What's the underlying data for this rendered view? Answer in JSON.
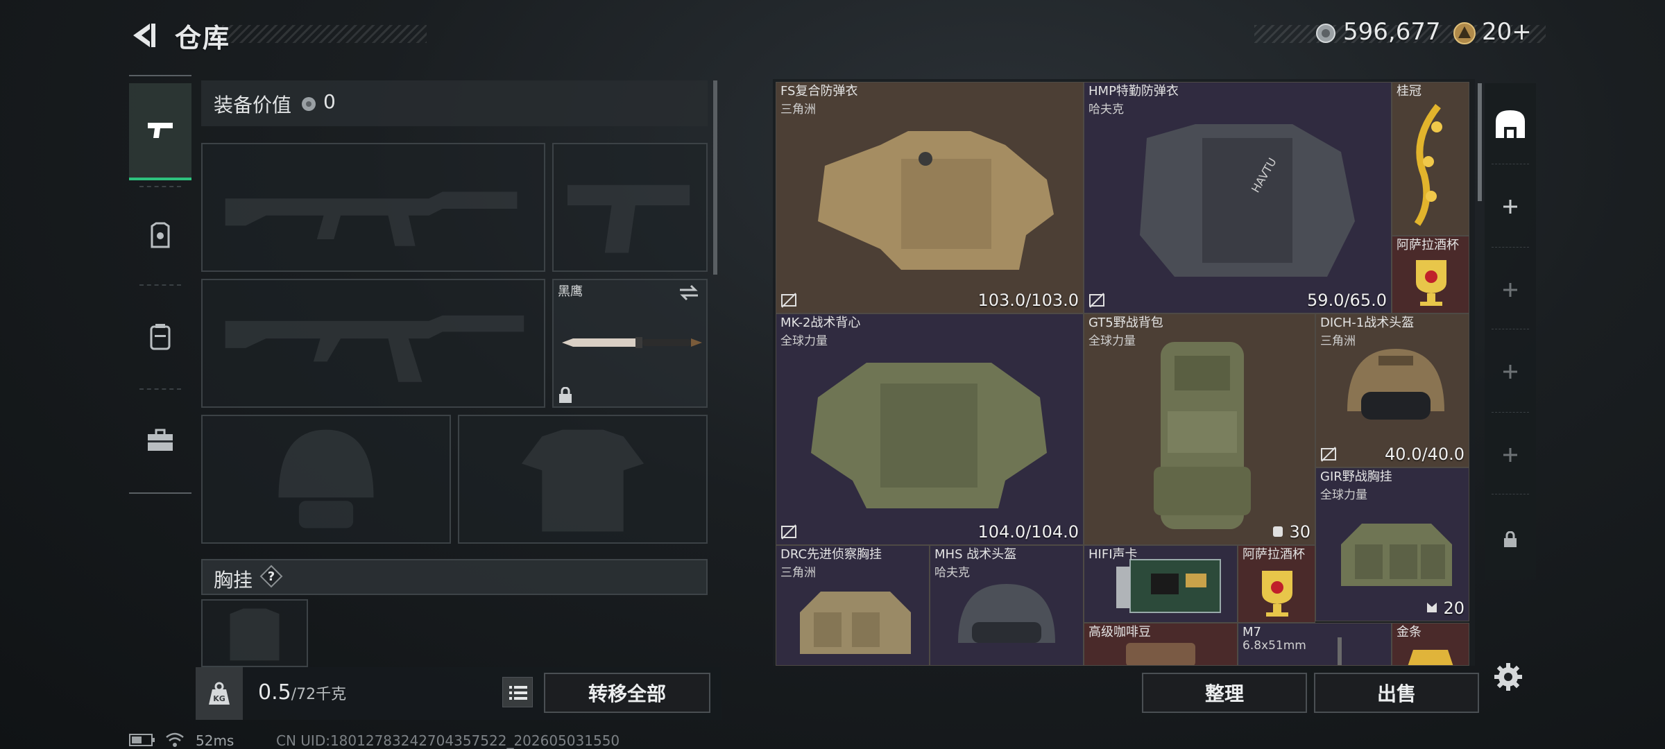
{
  "header": {
    "title": "仓库",
    "coins": "596,677",
    "bonds": "20",
    "bonds_add": "+"
  },
  "equipment": {
    "value_label": "装备价值",
    "value": "0",
    "melee_name": "黑鹰",
    "chest_label": "胸挂",
    "chest_help": "?"
  },
  "footer": {
    "weight_current": "0.5",
    "weight_max": "/72千克",
    "transfer_all": "转移全部",
    "organize": "整理",
    "sell": "出售"
  },
  "status": {
    "ping": "52ms",
    "uid": "CN UID:18012783242704357522_202605031550"
  },
  "storage": {
    "items": [
      {
        "name": "FS复合防弹衣",
        "sub": "三角洲",
        "value": "103.0/103.0"
      },
      {
        "name": "HMP特勤防弹衣",
        "sub": "哈夫克",
        "value": "59.0/65.0"
      },
      {
        "name": "桂冠",
        "sub": "",
        "value": ""
      },
      {
        "name": "阿萨拉酒杯",
        "sub": "",
        "value": ""
      },
      {
        "name": "MK-2战术背心",
        "sub": "全球力量",
        "value": "104.0/104.0"
      },
      {
        "name": "GT5野战背包",
        "sub": "全球力量",
        "value": "30"
      },
      {
        "name": "DICH-1战术头盔",
        "sub": "三角洲",
        "value": "40.0/40.0"
      },
      {
        "name": "GIR野战胸挂",
        "sub": "全球力量",
        "value": "20"
      },
      {
        "name": "DRC先进侦察胸挂",
        "sub": "三角洲",
        "value": ""
      },
      {
        "name": "MHS 战术头盔",
        "sub": "哈夫克",
        "value": ""
      },
      {
        "name": "HIFI声卡",
        "sub": "",
        "value": ""
      },
      {
        "name": "阿萨拉酒杯",
        "sub": "",
        "value": ""
      },
      {
        "name": "高级咖啡豆",
        "sub": "",
        "value": ""
      },
      {
        "name": "M7",
        "sub": "6.8x51mm",
        "value": ""
      },
      {
        "name": "金条",
        "sub": "",
        "value": ""
      }
    ]
  },
  "colors": {
    "accent_green": "#2ec27e",
    "rarity_brown": "#4c3f35",
    "rarity_purple": "#302b40",
    "rarity_gold": "#5a4a2e",
    "rarity_red": "#4a2a2a"
  },
  "icons": {
    "back": "back-arrow-icon",
    "coin": "coin-icon",
    "bond": "bond-icon",
    "weight": "weight-icon",
    "list": "list-icon",
    "settings": "gear-icon",
    "lock": "lock-icon"
  }
}
